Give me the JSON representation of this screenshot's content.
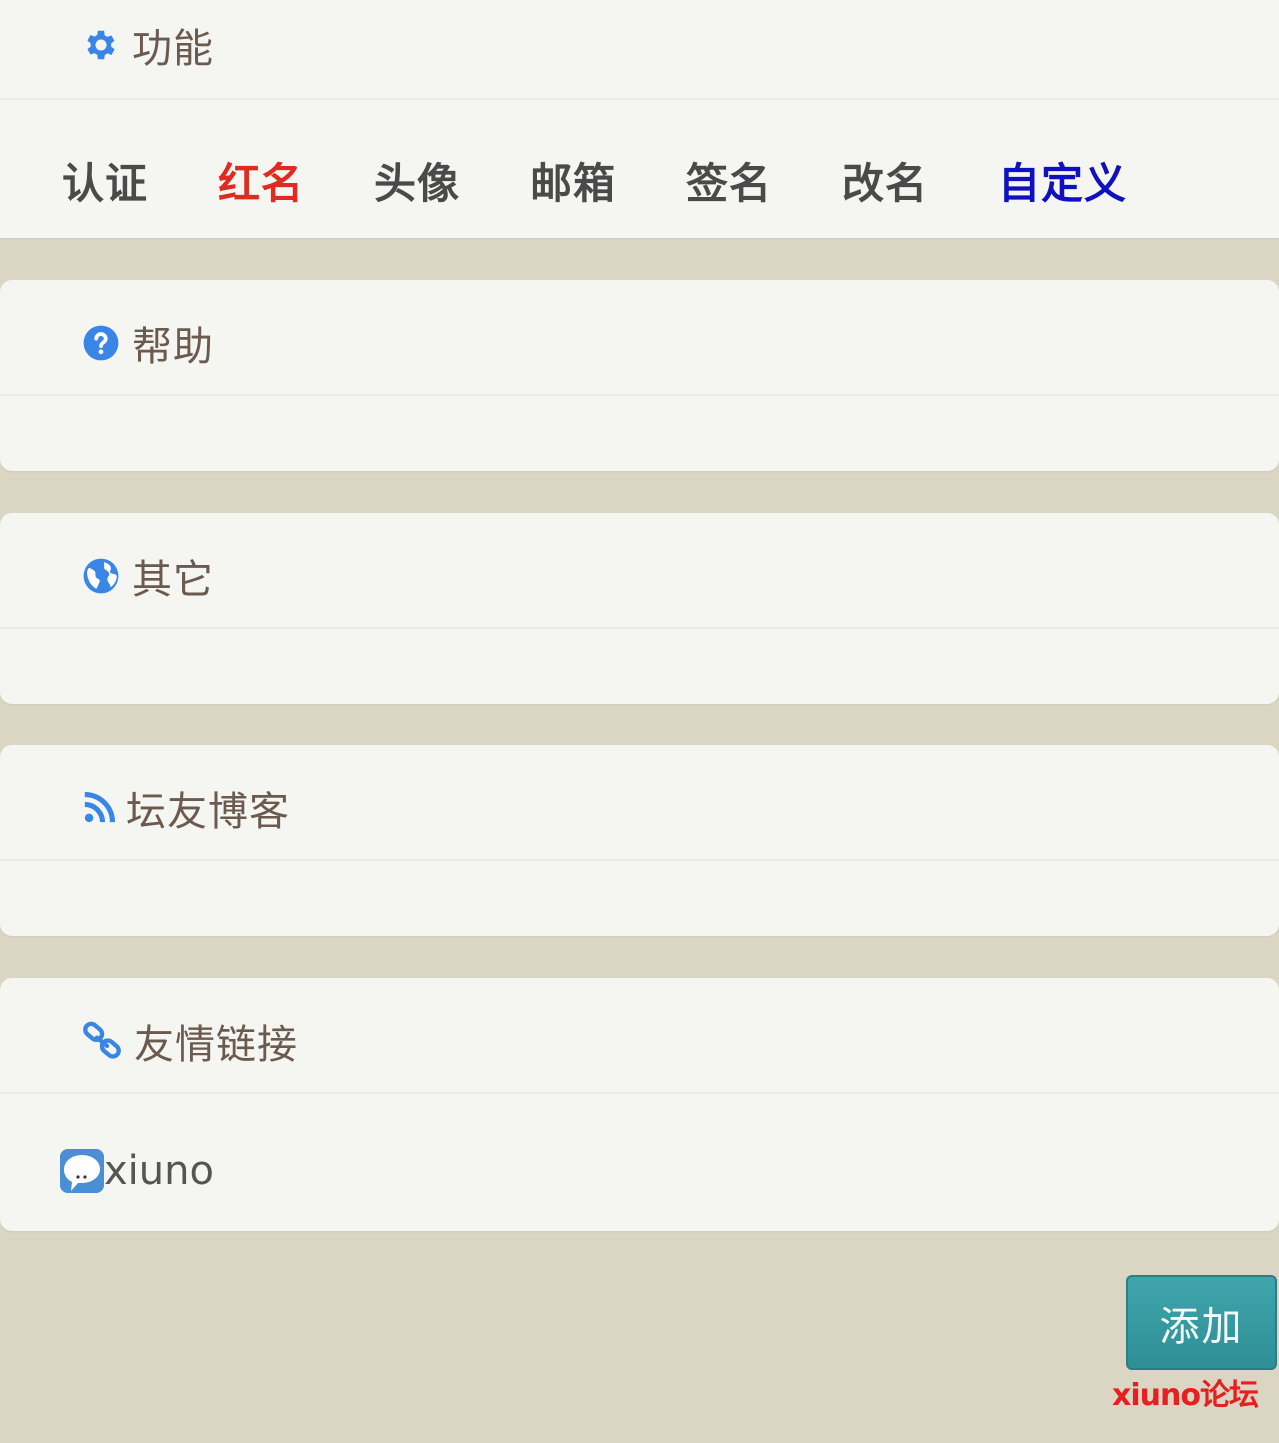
{
  "sections": {
    "features": {
      "title": "功能",
      "items": [
        {
          "label": "认证",
          "color": "#4a4a4a"
        },
        {
          "label": "红名",
          "color": "#e02b20"
        },
        {
          "label": "头像",
          "color": "#4a4a4a"
        },
        {
          "label": "邮箱",
          "color": "#4a4a4a"
        },
        {
          "label": "签名",
          "color": "#4a4a4a"
        },
        {
          "label": "改名",
          "color": "#4a4a4a"
        },
        {
          "label": "自定义",
          "color": "#1010c0"
        }
      ]
    },
    "help": {
      "title": "帮助"
    },
    "other": {
      "title": "其它"
    },
    "blogs": {
      "title": "坛友博客"
    },
    "links": {
      "title": "友情链接",
      "items": [
        {
          "label": "xiuno",
          "icon": "xiuno-logo-icon"
        }
      ]
    }
  },
  "add_button": {
    "label": "添加"
  },
  "watermark": "xiuno论坛",
  "colors": {
    "icon_blue": "#3a86e6",
    "page_bg": "#dbd6c4",
    "card_bg": "#f5f5f2",
    "button_teal": "#3a9ea5"
  }
}
